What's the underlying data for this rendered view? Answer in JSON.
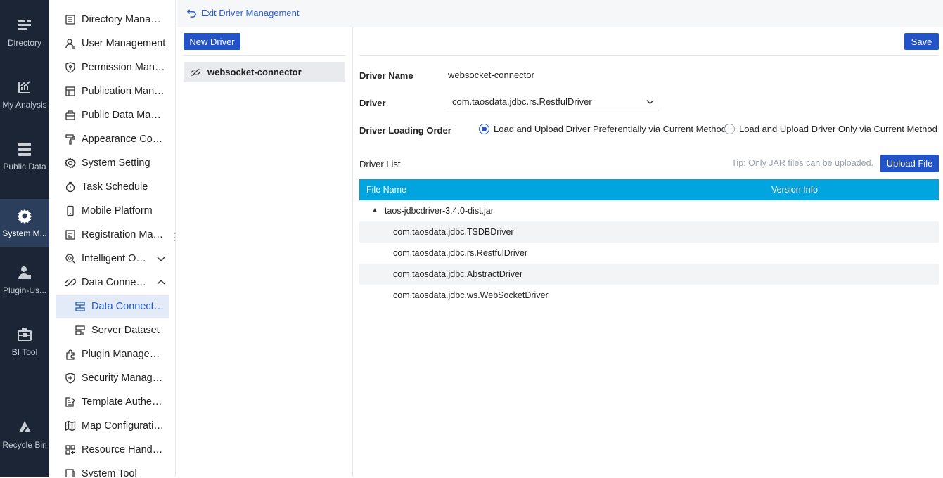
{
  "rail": [
    {
      "label": "Directory",
      "icon": "directory-icon"
    },
    {
      "label": "My Analysis",
      "icon": "analysis-icon"
    },
    {
      "label": "Public Data",
      "icon": "public-data-icon"
    },
    {
      "label": "System M...",
      "icon": "system-gear-icon",
      "active": true
    },
    {
      "label": "Plugin-Us...",
      "icon": "plugin-user-icon"
    },
    {
      "label": "BI Tool",
      "icon": "bi-tool-icon"
    },
    {
      "label": "Recycle Bin",
      "icon": "recycle-bin-icon"
    }
  ],
  "menu": [
    {
      "label": "Directory Mana…",
      "icon": "list-icon"
    },
    {
      "label": "User Management",
      "icon": "user-icon"
    },
    {
      "label": "Permission Man…",
      "icon": "permission-icon"
    },
    {
      "label": "Publication Man…",
      "icon": "publication-icon"
    },
    {
      "label": "Public Data Ma…",
      "icon": "public-data-icon"
    },
    {
      "label": "Appearance Co…",
      "icon": "brush-icon"
    },
    {
      "label": "System Setting",
      "icon": "gear-icon"
    },
    {
      "label": "Task Schedule",
      "icon": "timer-icon"
    },
    {
      "label": "Mobile Platform",
      "icon": "mobile-icon"
    },
    {
      "label": "Registration Ma…",
      "icon": "registration-icon"
    },
    {
      "label": "Intelligent O…",
      "icon": "intelligent-icon",
      "chevron": "down"
    },
    {
      "label": "Data Conne…",
      "icon": "link-icon",
      "chevron": "up"
    },
    {
      "label": "Data Connect…",
      "icon": "connection-icon",
      "sub": true,
      "selected": true
    },
    {
      "label": "Server Dataset",
      "icon": "dataset-icon",
      "sub": true
    },
    {
      "label": "Plugin Manage…",
      "icon": "plugin-icon"
    },
    {
      "label": "Security Manag…",
      "icon": "shield-icon"
    },
    {
      "label": "Template Authe…",
      "icon": "template-icon"
    },
    {
      "label": "Map Configurati…",
      "icon": "map-icon"
    },
    {
      "label": "Resource Hand…",
      "icon": "resource-icon"
    },
    {
      "label": "System Tool",
      "icon": "tool-icon"
    }
  ],
  "topbar": {
    "exit_label": "Exit Driver Management"
  },
  "driver_panel": {
    "new_driver_label": "New Driver",
    "drivers": [
      "websocket-connector"
    ]
  },
  "detail": {
    "save_label": "Save",
    "driver_name_label": "Driver Name",
    "driver_name_value": "websocket-connector",
    "driver_label": "Driver",
    "driver_value": "com.taosdata.jdbc.rs.RestfulDriver",
    "loading_order_label": "Driver Loading Order",
    "loading_options": [
      {
        "label": "Load and Upload Driver Preferentially via Current Method",
        "checked": true
      },
      {
        "label": "Load and Upload Driver Only via Current Method",
        "checked": false
      }
    ],
    "driver_list_label": "Driver List",
    "tip": "Tip: Only JAR files can be uploaded.",
    "upload_label": "Upload File",
    "table": {
      "headers": [
        "File Name",
        "Version Info"
      ],
      "jar": "taos-jdbcdriver-3.4.0-dist.jar",
      "classes": [
        "com.taosdata.jdbc.TSDBDriver",
        "com.taosdata.jdbc.rs.RestfulDriver",
        "com.taosdata.jdbc.AbstractDriver",
        "com.taosdata.jdbc.ws.WebSocketDriver"
      ]
    }
  },
  "colors": {
    "rail_bg": "#1b2536",
    "accent": "#2253c8",
    "table_header": "#00a5df"
  }
}
